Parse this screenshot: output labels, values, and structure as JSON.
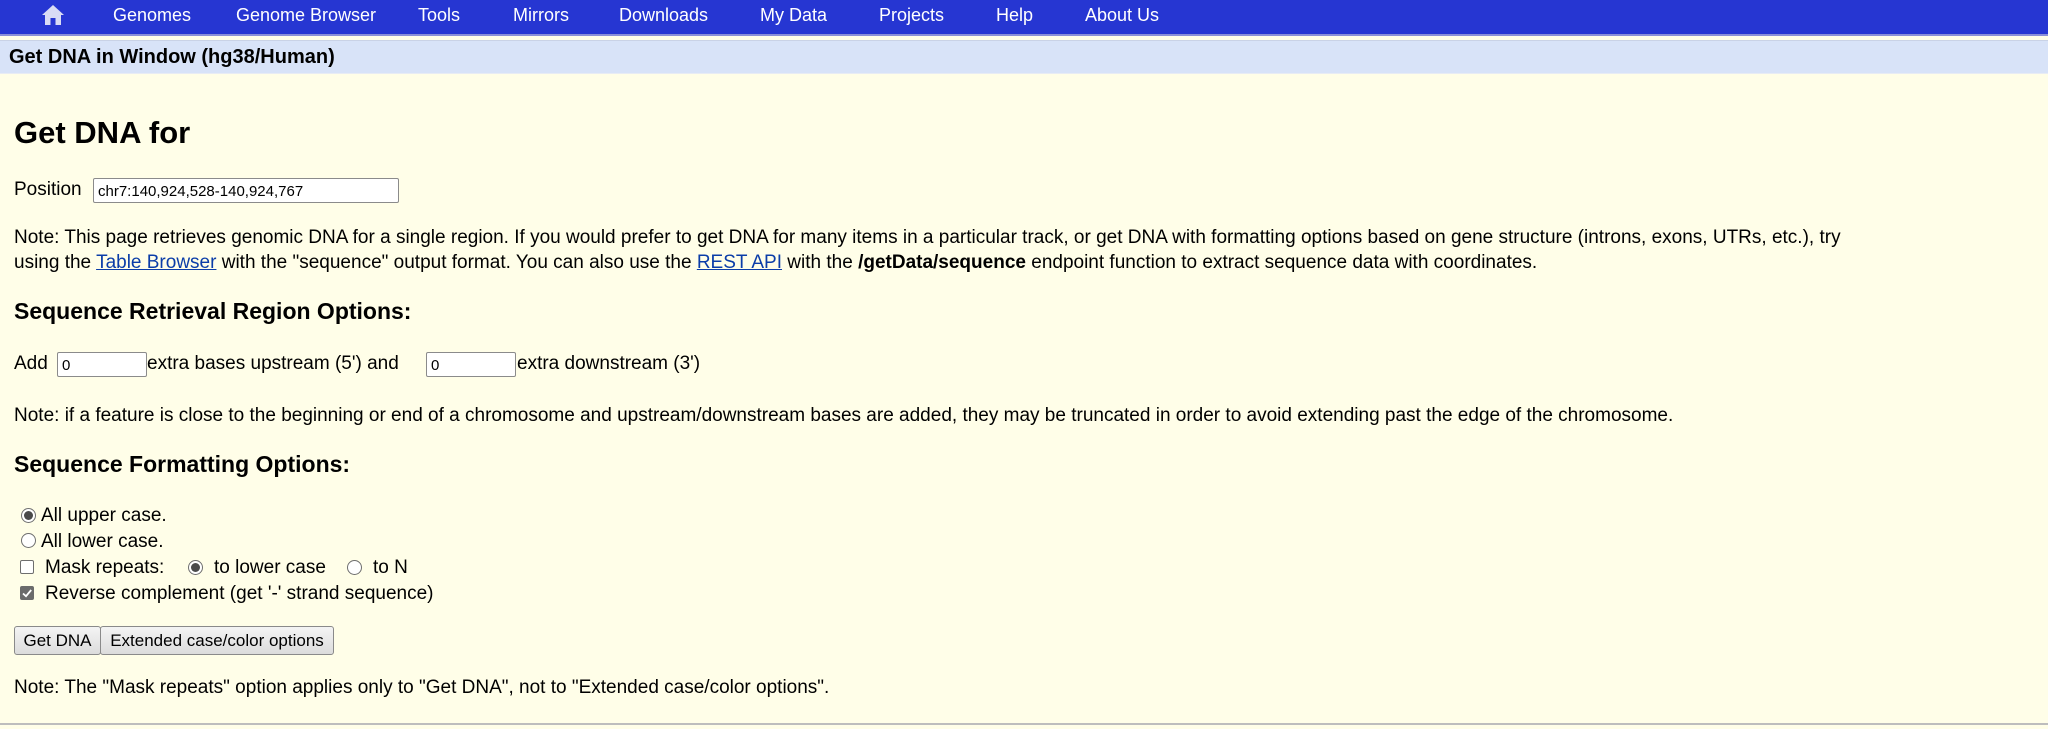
{
  "nav": {
    "items": [
      "Genomes",
      "Genome Browser",
      "Tools",
      "Mirrors",
      "Downloads",
      "My Data",
      "Projects",
      "Help",
      "About Us"
    ]
  },
  "page": {
    "strip_title": "Get DNA in Window (hg38/Human)",
    "heading": "Get DNA for"
  },
  "position": {
    "label": "Position",
    "value": "chr7:140,924,528-140,924,767"
  },
  "intro_note": {
    "line1": "Note: This page retrieves genomic DNA for a single region. If you would prefer to get DNA for many items in a particular track, or get DNA with formatting options based on gene structure (introns, exons, UTRs, etc.), try",
    "line2_prefix": "using the ",
    "table_browser_link": "Table Browser",
    "line2_mid": " with the \"sequence\" output format. You can also use the ",
    "rest_api_link": "REST API",
    "line2_mid2": " with the ",
    "endpoint": "/getData/sequence",
    "line2_suffix": " endpoint function to extract sequence data with coordinates."
  },
  "region_options": {
    "heading": "Sequence Retrieval Region Options:",
    "add_label": "Add",
    "upstream_value": "0",
    "upstream_label": "extra bases upstream (5') and",
    "downstream_value": "0",
    "downstream_label": "extra downstream (3')",
    "note": "Note: if a feature is close to the beginning or end of a chromosome and upstream/downstream bases are added, they may be truncated in order to avoid extending past the edge of the chromosome."
  },
  "format_options": {
    "heading": "Sequence Formatting Options:",
    "upper_case": "All upper case.",
    "lower_case": "All lower case.",
    "mask_repeats": "Mask repeats:",
    "to_lower_case": "to lower case",
    "to_n": "to N",
    "reverse_complement": "Reverse complement (get '-' strand sequence)",
    "upper_case_selected": true,
    "mask_repeats_checked": false,
    "mask_to_lower_selected": true,
    "reverse_complement_checked": true
  },
  "buttons": {
    "get_dna": "Get DNA",
    "extended": "Extended case/color options"
  },
  "footer_note": "Note: The \"Mask repeats\" option applies only to \"Get DNA\", not to \"Extended case/color options\".",
  "icons": {
    "home": "home-icon"
  },
  "colors": {
    "nav_bg": "#2636d2",
    "page_bg": "#fffee8",
    "title_strip_bg": "#d8e3f8",
    "link": "#0b3da8"
  }
}
